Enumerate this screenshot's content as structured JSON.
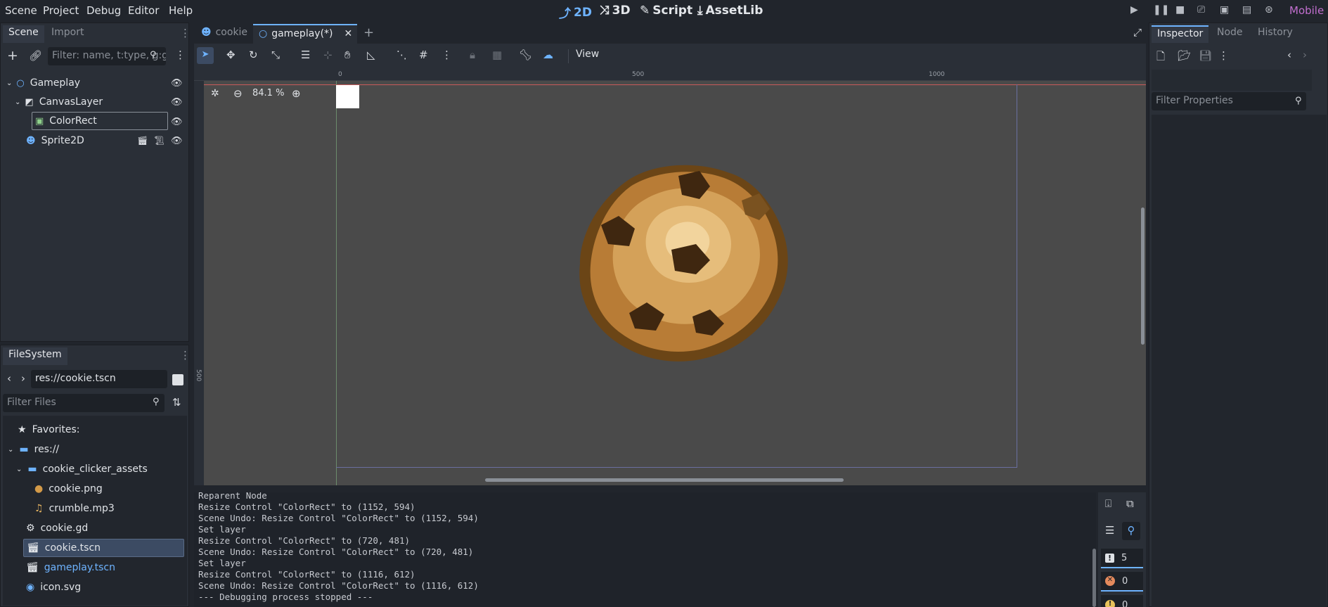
{
  "menu": {
    "scene": "Scene",
    "project": "Project",
    "debug": "Debug",
    "editor": "Editor",
    "help": "Help"
  },
  "modes": {
    "m2d": "2D",
    "m3d": "3D",
    "script": "Script",
    "assetlib": "AssetLib"
  },
  "renderer": "Mobile",
  "scene_dock": {
    "tab_scene": "Scene",
    "tab_import": "Import",
    "filter_placeholder": "Filter: name, t:type, g:group",
    "nodes": [
      {
        "label": "Gameplay"
      },
      {
        "label": "CanvasLayer"
      },
      {
        "label": "ColorRect"
      },
      {
        "label": "Sprite2D"
      }
    ]
  },
  "filesystem": {
    "tab": "FileSystem",
    "path": "res://cookie.tscn",
    "filter_placeholder": "Filter Files",
    "items": [
      {
        "label": "Favorites:"
      },
      {
        "label": "res://"
      },
      {
        "label": "cookie_clicker_assets"
      },
      {
        "label": "cookie.png"
      },
      {
        "label": "crumble.mp3"
      },
      {
        "label": "cookie.gd"
      },
      {
        "label": "cookie.tscn"
      },
      {
        "label": "gameplay.tscn"
      },
      {
        "label": "icon.svg"
      }
    ]
  },
  "editor_tabs": [
    {
      "label": "cookie"
    },
    {
      "label": "gameplay(*)"
    }
  ],
  "toolbar": {
    "view_label": "View"
  },
  "viewport": {
    "zoom": "84.1 %",
    "ruler_ticks": [
      "0",
      "500",
      "1000"
    ],
    "vruler_tick": "500"
  },
  "inspector": {
    "tab_inspector": "Inspector",
    "tab_node": "Node",
    "tab_history": "History",
    "filter_placeholder": "Filter Properties"
  },
  "console": {
    "lines": [
      "Reparent Node",
      "Resize Control \"ColorRect\" to (1152, 594)",
      "Scene Undo: Resize Control \"ColorRect\" to (1152, 594)",
      "Set layer",
      "Resize Control \"ColorRect\" to (720, 481)",
      "Scene Undo: Resize Control \"ColorRect\" to (720, 481)",
      "Set layer",
      "Resize Control \"ColorRect\" to (1116, 612)",
      "Scene Undo: Resize Control \"ColorRect\" to (1116, 612)",
      "--- Debugging process stopped ---"
    ],
    "count_messages": "5",
    "count_errors": "0",
    "count_warnings": "0"
  },
  "colors": {
    "accent": "#6eb3ff",
    "renderer": "#c26fcf",
    "selection": "#3c4b63"
  }
}
